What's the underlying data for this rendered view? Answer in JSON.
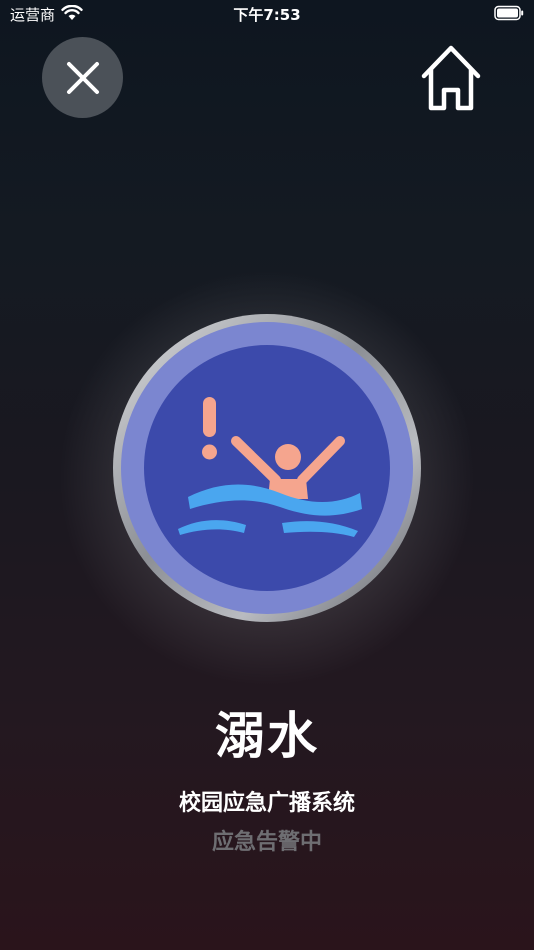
{
  "status_bar": {
    "carrier": "运营商",
    "time": "下午7:53",
    "wifi_icon": "wifi-icon",
    "battery_icon": "battery-icon"
  },
  "header": {
    "close_icon": "close-icon",
    "home_icon": "home-icon"
  },
  "alert": {
    "icon": "drowning-icon",
    "title": "溺水",
    "system_name": "校园应急广播系统",
    "status": "应急告警中"
  },
  "colors": {
    "badge_outer": "#7b86d0",
    "badge_inner": "#3c4aab",
    "figure": "#f5a58e",
    "water": "#4aa6ef",
    "status_text": "#6e6e72"
  }
}
